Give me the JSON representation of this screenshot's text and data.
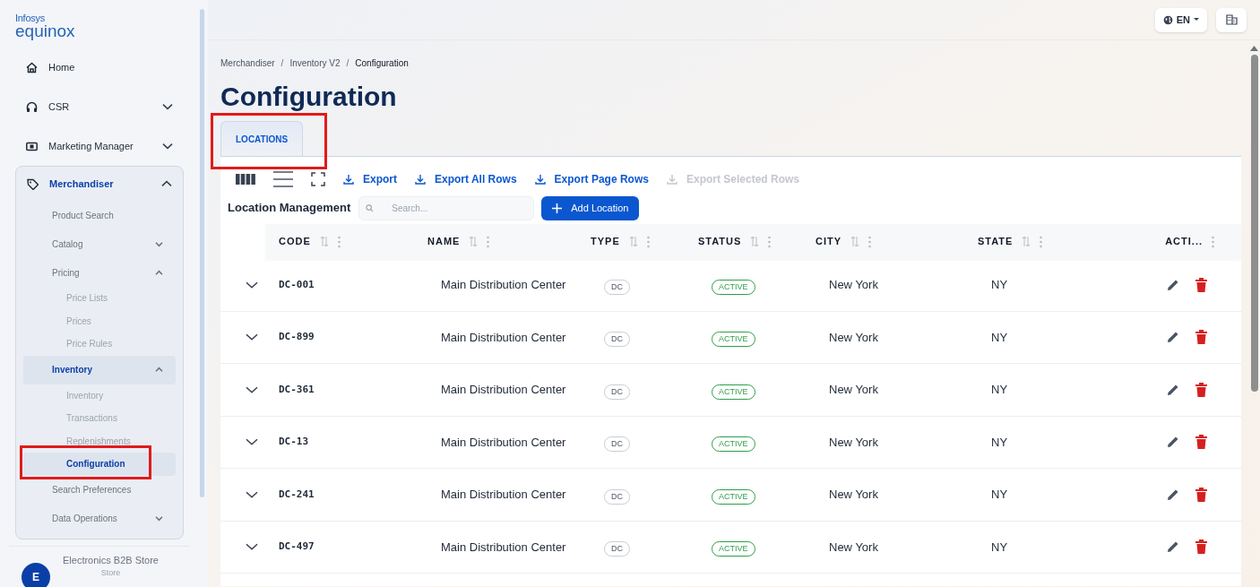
{
  "logo": {
    "top": "Infosys",
    "bottom": "equinox"
  },
  "nav": [
    {
      "label": "Home",
      "has_children": false
    },
    {
      "label": "CSR",
      "expanded": false,
      "has_children": true
    },
    {
      "label": "Marketing Manager",
      "expanded": false,
      "has_children": true
    },
    {
      "label": "Merchandiser",
      "expanded": true,
      "has_children": true,
      "children": [
        {
          "label": "Product Search",
          "selected": false,
          "has_children": false
        },
        {
          "label": "Catalog",
          "selected": false,
          "expanded": false,
          "has_children": true
        },
        {
          "label": "Pricing",
          "selected": false,
          "expanded": true,
          "has_children": true,
          "children": [
            {
              "label": "Price Lists",
              "selected": false,
              "highlighted": false
            },
            {
              "label": "Prices",
              "selected": false,
              "highlighted": false
            },
            {
              "label": "Price Rules",
              "selected": false,
              "highlighted": false
            }
          ]
        },
        {
          "label": "Inventory",
          "selected": true,
          "expanded": true,
          "has_children": true,
          "children": [
            {
              "label": "Inventory",
              "selected": false,
              "highlighted": false
            },
            {
              "label": "Transactions",
              "selected": false,
              "highlighted": false
            },
            {
              "label": "Replenishments",
              "selected": false,
              "highlighted": false
            },
            {
              "label": "Configuration",
              "selected": true,
              "highlighted": true
            }
          ]
        },
        {
          "label": "Search Preferences",
          "selected": false,
          "has_children": false
        },
        {
          "label": "Data Operations",
          "selected": false,
          "expanded": false,
          "has_children": true
        }
      ]
    }
  ],
  "store": {
    "initial": "E",
    "name": "Electronics B2B Store",
    "subtitle": "Store"
  },
  "header": {
    "language": "EN"
  },
  "breadcrumb": [
    {
      "kind": "link",
      "text": "Merchandiser"
    },
    {
      "kind": "separator",
      "text": "/"
    },
    {
      "kind": "link",
      "text": "Inventory V2"
    },
    {
      "kind": "separator",
      "text": "/"
    },
    {
      "kind": "current",
      "text": "Configuration"
    }
  ],
  "title": "Configuration",
  "tabs": [
    {
      "label": "LOCATIONS",
      "selected": true,
      "highlighted": true
    }
  ],
  "toolbar": {
    "actions": [
      {
        "label": "Export",
        "disabled": false
      },
      {
        "label": "Export All Rows",
        "disabled": false
      },
      {
        "label": "Export Page Rows",
        "disabled": false
      },
      {
        "label": "Export Selected Rows",
        "disabled": true
      }
    ],
    "table_title": "Location Management",
    "search": {
      "placeholder": "Search..."
    },
    "add_button": "Add Location"
  },
  "table": {
    "columns": [
      "CODE",
      "NAME",
      "TYPE",
      "STATUS",
      "CITY",
      "STATE",
      "ACTI..."
    ],
    "rows": [
      {
        "code": "DC-001",
        "name": "Main Distribution Center",
        "type": "DC",
        "status": "ACTIVE",
        "city": "New York",
        "state": "NY"
      },
      {
        "code": "DC-899",
        "name": "Main Distribution Center",
        "type": "DC",
        "status": "ACTIVE",
        "city": "New York",
        "state": "NY"
      },
      {
        "code": "DC-361",
        "name": "Main Distribution Center",
        "type": "DC",
        "status": "ACTIVE",
        "city": "New York",
        "state": "NY"
      },
      {
        "code": "DC-13",
        "name": "Main Distribution Center",
        "type": "DC",
        "status": "ACTIVE",
        "city": "New York",
        "state": "NY"
      },
      {
        "code": "DC-241",
        "name": "Main Distribution Center",
        "type": "DC",
        "status": "ACTIVE",
        "city": "New York",
        "state": "NY"
      },
      {
        "code": "DC-497",
        "name": "Main Distribution Center",
        "type": "DC",
        "status": "ACTIVE",
        "city": "New York",
        "state": "NY"
      }
    ]
  }
}
